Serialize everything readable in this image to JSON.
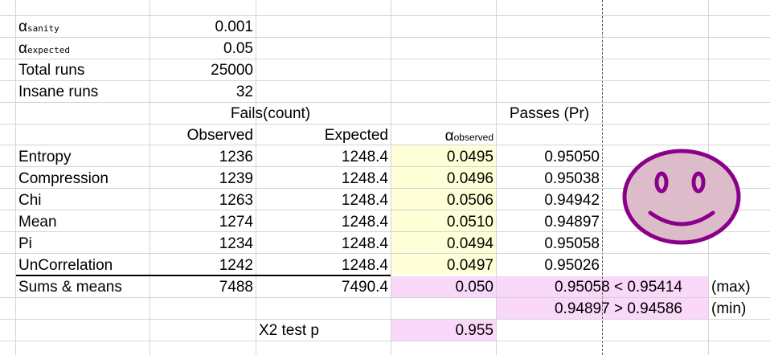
{
  "params": {
    "alpha_sanity": {
      "symbol": "α",
      "sub": "sanity",
      "value": "0.001"
    },
    "alpha_expected": {
      "symbol": "α",
      "sub": "expected",
      "value": "0.05"
    },
    "total_runs": {
      "label": "Total runs",
      "value": "25000"
    },
    "insane_runs": {
      "label": "Insane runs",
      "value": "32"
    }
  },
  "headers": {
    "fails_count": "Fails(count)",
    "passes_pr": "Passes (Pr)",
    "observed": "Observed",
    "expected": "Expected",
    "alpha_observed_symbol": "α",
    "alpha_observed_sub": "observed"
  },
  "rows": [
    {
      "name": "Entropy",
      "observed": "1236",
      "expected": "1248.4",
      "alpha": "0.0495",
      "passes": "0.95050"
    },
    {
      "name": "Compression",
      "observed": "1239",
      "expected": "1248.4",
      "alpha": "0.0496",
      "passes": "0.95038"
    },
    {
      "name": "Chi",
      "observed": "1263",
      "expected": "1248.4",
      "alpha": "0.0506",
      "passes": "0.94942"
    },
    {
      "name": "Mean",
      "observed": "1274",
      "expected": "1248.4",
      "alpha": "0.0510",
      "passes": "0.94897"
    },
    {
      "name": "Pi",
      "observed": "1234",
      "expected": "1248.4",
      "alpha": "0.0494",
      "passes": "0.95058"
    },
    {
      "name": "UnCorrelation",
      "observed": "1242",
      "expected": "1248.4",
      "alpha": "0.0497",
      "passes": "0.95026"
    }
  ],
  "sums": {
    "label": "Sums & means",
    "observed": "7488",
    "expected": "7490.4",
    "alpha": "0.050",
    "max_text": "0.95058 < 0.95414",
    "max_label": "(max)",
    "min_text": "0.94897 > 0.94586",
    "min_label": "(min)"
  },
  "chi_test": {
    "label": "X2  test p",
    "value": "0.955"
  },
  "colors": {
    "highlight_yellow": "#ffffd7",
    "highlight_pink": "#f9d8f9",
    "smiley_fill": "#dcbcc9",
    "smiley_stroke": "#8b008b"
  },
  "icons": {
    "smiley": "smiley-face-icon"
  }
}
